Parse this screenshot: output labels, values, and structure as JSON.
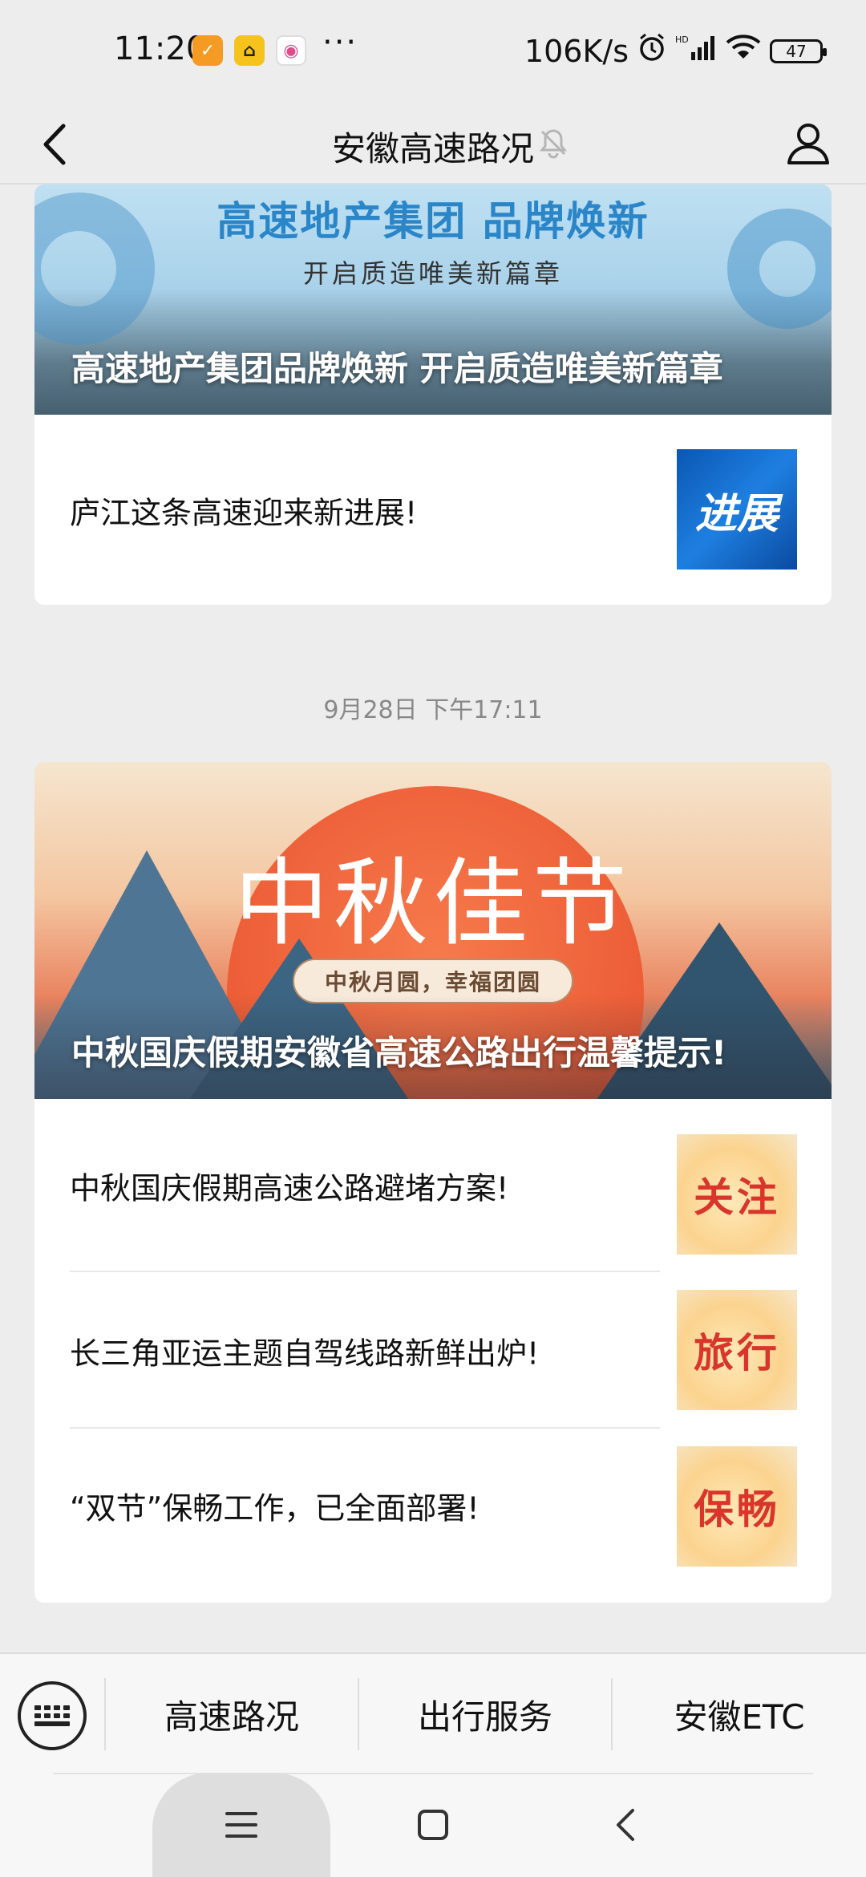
{
  "status_bar": {
    "time": "11:20",
    "network_speed": "106K/s",
    "battery": "47",
    "overflow": "···"
  },
  "header": {
    "title": "安徽高速路况"
  },
  "articles": [
    {
      "banner": {
        "title": "高速地产集团 品牌焕新",
        "subtitle": "开启质造唯美新篇章",
        "caption": "高速地产集团品牌焕新 开启质造唯美新篇章"
      },
      "items": [
        {
          "text": "庐江这条高速迎来新进展!",
          "thumb_text": "进展"
        }
      ]
    },
    {
      "timestamp": "9月28日 下午17:11",
      "banner": {
        "title": "中秋佳节",
        "subtitle": "中秋月圆，幸福团圆",
        "caption": "中秋国庆假期安徽省高速公路出行温馨提示!"
      },
      "items": [
        {
          "text": "中秋国庆假期高速公路避堵方案!",
          "thumb_text": "关注"
        },
        {
          "text": "长三角亚运主题自驾线路新鲜出炉!",
          "thumb_text": "旅行"
        },
        {
          "text": "“双节”保畅工作，已全面部署!",
          "thumb_text": "保畅"
        }
      ]
    }
  ],
  "bottom_menu": {
    "items": [
      "高速路况",
      "出行服务",
      "安徽ETC"
    ]
  },
  "colors": {
    "background": "#ededed",
    "card": "#ffffff",
    "timestamp": "#888888",
    "accent_blue": "#2a86c8",
    "accent_red": "#d9352b"
  }
}
